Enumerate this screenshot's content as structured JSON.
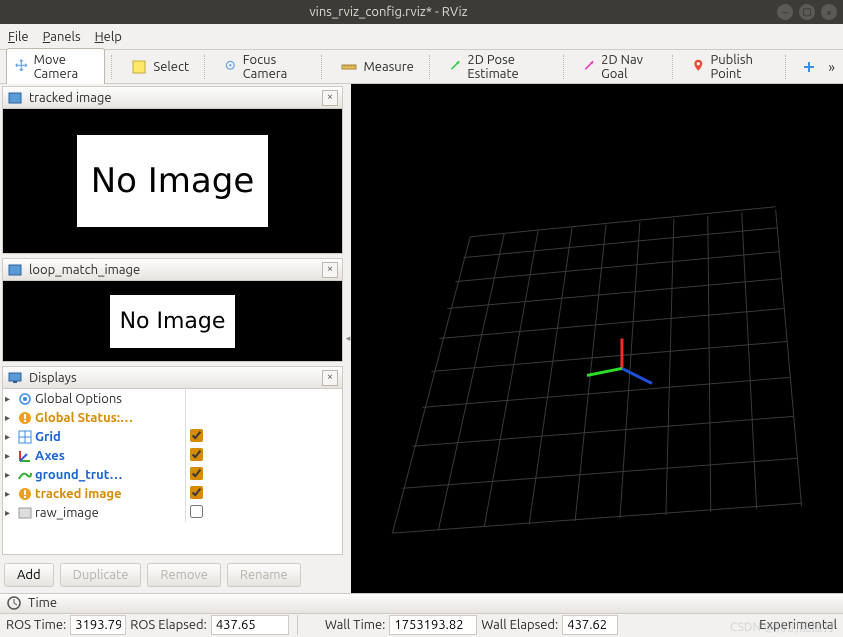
{
  "window": {
    "title": "vins_rviz_config.rviz* - RViz"
  },
  "menubar": {
    "file": "File",
    "panels": "Panels",
    "help": "Help"
  },
  "toolbar": {
    "move_camera": "Move Camera",
    "select": "Select",
    "focus_camera": "Focus Camera",
    "measure": "Measure",
    "pose_estimate": "2D Pose Estimate",
    "nav_goal": "2D Nav Goal",
    "publish_point": "Publish Point"
  },
  "panels": {
    "tracked_image": {
      "title": "tracked image",
      "message": "No Image"
    },
    "loop_match_image": {
      "title": "loop_match_image",
      "message": "No Image"
    },
    "displays": {
      "title": "Displays",
      "items": [
        {
          "label": "Global Options",
          "style": "",
          "checked": null
        },
        {
          "label": "Global Status:…",
          "style": "orange",
          "checked": null
        },
        {
          "label": "Grid",
          "style": "blue",
          "checked": true
        },
        {
          "label": "Axes",
          "style": "blue",
          "checked": true
        },
        {
          "label": "ground_trut…",
          "style": "blue",
          "checked": true
        },
        {
          "label": "tracked image",
          "style": "orange",
          "checked": true
        },
        {
          "label": "raw_image",
          "style": "",
          "checked": false
        }
      ],
      "buttons": {
        "add": "Add",
        "duplicate": "Duplicate",
        "remove": "Remove",
        "rename": "Rename"
      }
    }
  },
  "time": {
    "title": "Time",
    "ros_time_label": "ROS Time:",
    "ros_time_value": "3193.79",
    "ros_elapsed_label": "ROS Elapsed:",
    "ros_elapsed_value": "437.65",
    "wall_time_label": "Wall Time:",
    "wall_time_value": "1753193.82",
    "wall_elapsed_label": "Wall Elapsed:",
    "wall_elapsed_value": "437.62",
    "experimental": "Experimental"
  },
  "watermark": "CSDN @特别能捡打"
}
